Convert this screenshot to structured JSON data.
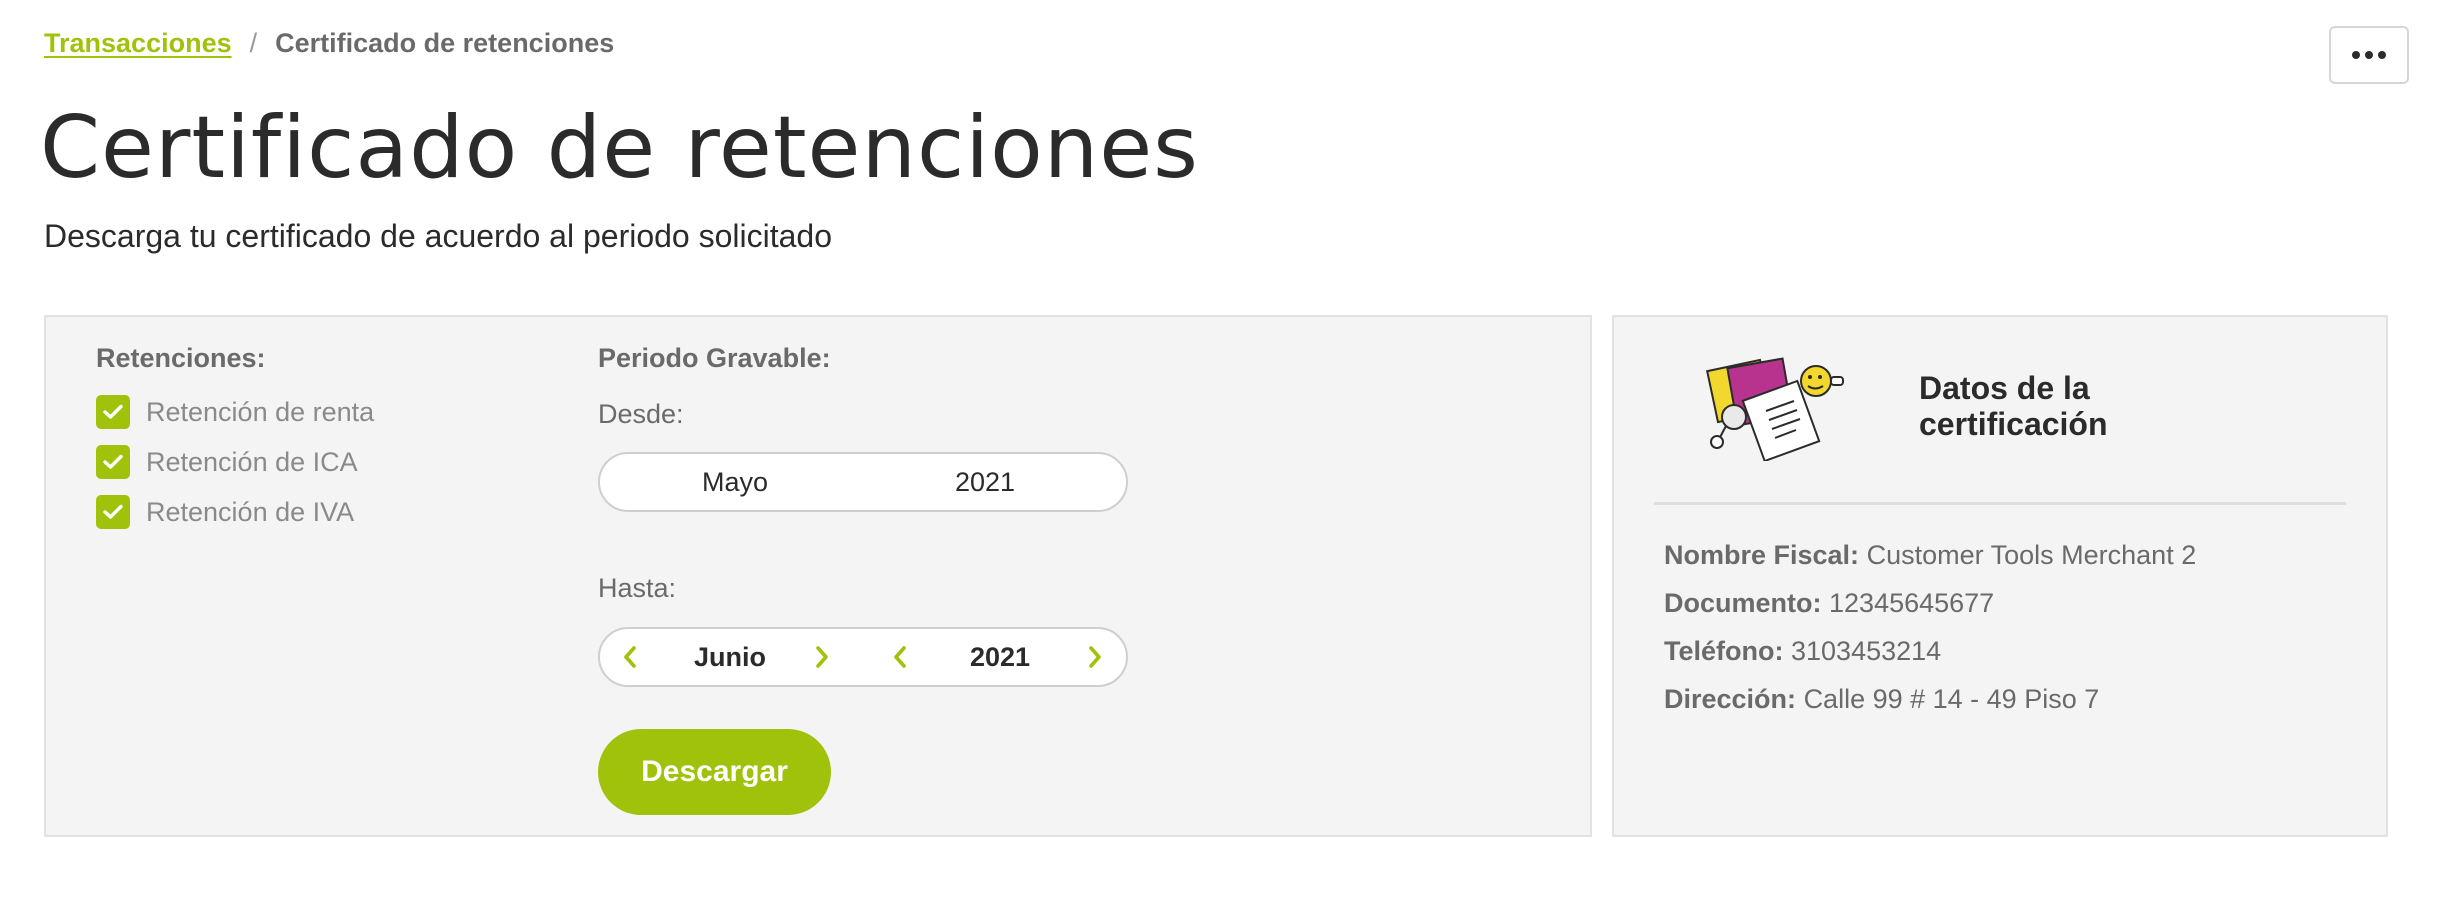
{
  "breadcrumb": {
    "parent": "Transacciones",
    "separator": "/",
    "current": "Certificado de retenciones"
  },
  "header": {
    "title": "Certificado de retenciones",
    "subtitle": "Descarga tu certificado de acuerdo al periodo solicitado"
  },
  "retenciones": {
    "label": "Retenciones:",
    "items": [
      {
        "label": "Retención de renta",
        "checked": true
      },
      {
        "label": "Retención de ICA",
        "checked": true
      },
      {
        "label": "Retención de IVA",
        "checked": true
      }
    ]
  },
  "periodo": {
    "label": "Periodo Gravable:",
    "desde": {
      "label": "Desde:",
      "month": "Mayo",
      "year": "2021"
    },
    "hasta": {
      "label": "Hasta:",
      "month": "Junio",
      "year": "2021"
    }
  },
  "actions": {
    "download_label": "Descargar"
  },
  "certificacion": {
    "heading": "Datos de la certificación",
    "fields": [
      {
        "key": "Nombre Fiscal:",
        "value": "Customer Tools Merchant 2"
      },
      {
        "key": "Documento:",
        "value": "12345645677"
      },
      {
        "key": "Teléfono:",
        "value": "3103453214"
      },
      {
        "key": "Dirección:",
        "value": "Calle 99 # 14 - 49 Piso 7"
      }
    ]
  },
  "colors": {
    "accent": "#a0c20a",
    "panel_bg": "#f4f4f4",
    "illustration_magenta": "#b8338e",
    "illustration_yellow": "#f2d82e"
  }
}
